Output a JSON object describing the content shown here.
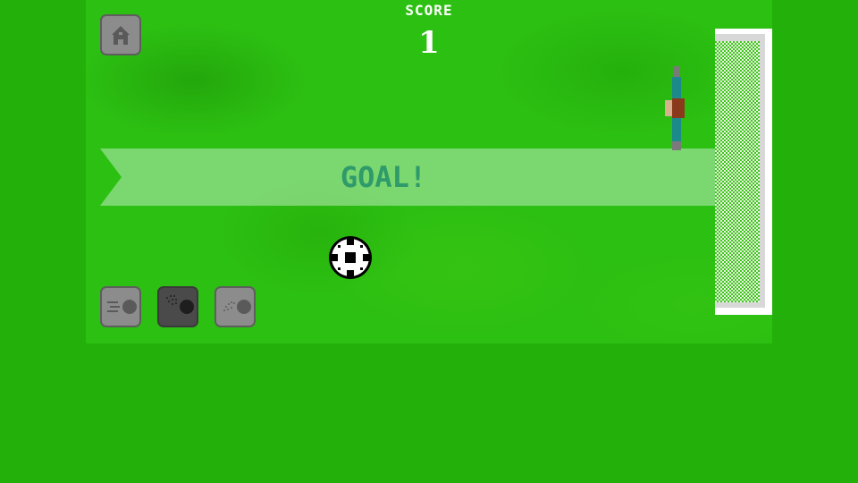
{
  "hud": {
    "score_label": "SCORE",
    "score_value": "1"
  },
  "banner": {
    "text": "GOAL!"
  },
  "buttons": {
    "home_icon": "house-icon",
    "shot_types": [
      {
        "icon": "straight-shot-icon",
        "selected": false
      },
      {
        "icon": "curve-shot-icon",
        "selected": true
      },
      {
        "icon": "lob-shot-icon",
        "selected": false
      }
    ]
  },
  "colors": {
    "field": "#2cc012",
    "background": "#23b00a",
    "button": "#8c8c8c",
    "button_selected": "#4a4a4a",
    "banner_text": "#2f9a6a",
    "goalkeeper_shirt": "#1c8a8a"
  }
}
